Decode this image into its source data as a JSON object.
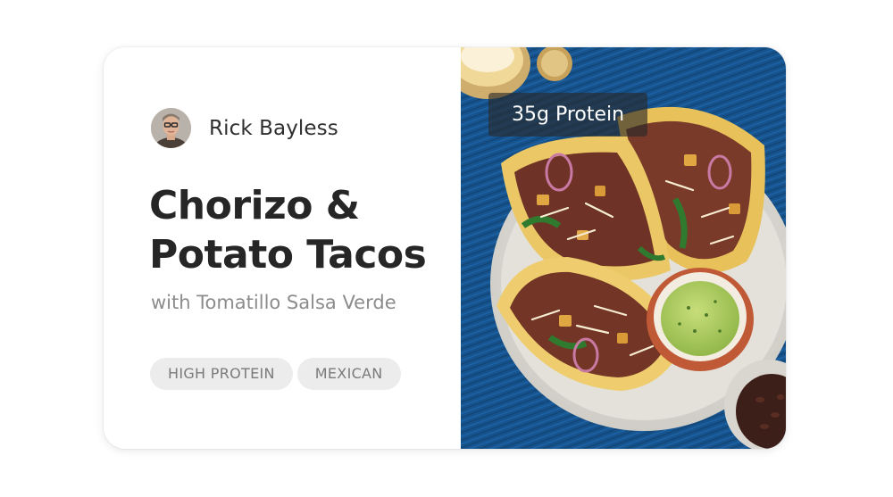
{
  "author": {
    "name": "Rick Bayless"
  },
  "recipe": {
    "title_line1": "Chorizo &",
    "title_line2": "Potato Tacos",
    "subtitle": "with Tomatillo Salsa Verde"
  },
  "tags": [
    {
      "label": "HIGH PROTEIN"
    },
    {
      "label": "MEXICAN"
    }
  ],
  "photo": {
    "badge": "35g Protein"
  },
  "colors": {
    "title": "#262626",
    "subtitle": "#8c8c8c",
    "tag_bg": "#ececec",
    "tablecloth": "#17558f"
  }
}
